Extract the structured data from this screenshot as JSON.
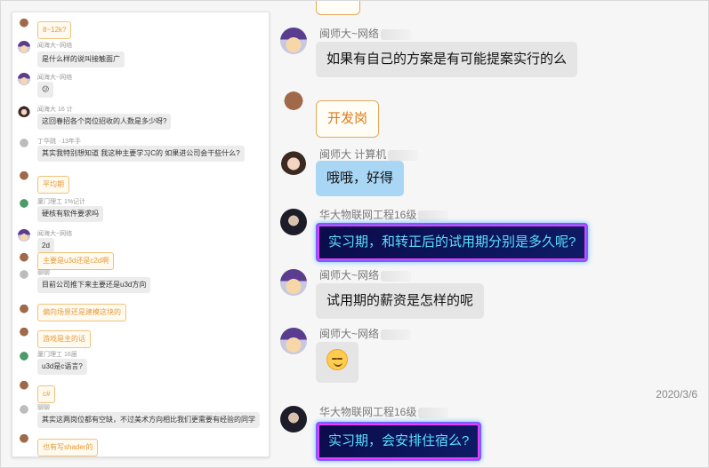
{
  "thumbnail_chat": {
    "messages": [
      {
        "name": "",
        "text": "8~12k?",
        "style": "orange",
        "avatar": "bear"
      },
      {
        "name": "闻海大~网络",
        "text": "是什么样的说叫接触面广",
        "style": "gray",
        "avatar": "kid"
      },
      {
        "name": "闻海大~网络",
        "text": "😕",
        "style": "gray",
        "avatar": "kid"
      },
      {
        "name": "闻海大 16 计",
        "text": "这回春招各个岗位招收的人数是多少呀?",
        "style": "gray",
        "avatar": "girl"
      },
      {
        "name": "丁华跳 · 13年手",
        "text": "其实我特别想知道 我这种主要学习C的 如果进公司会干些什么?",
        "style": "gray",
        "avatar": "grey"
      },
      {
        "name": "",
        "text": "平均期",
        "style": "orange",
        "avatar": "bear"
      },
      {
        "name": "厦门理工 1%记计",
        "text": "硬核有软件要求吗",
        "style": "gray",
        "avatar": "green"
      },
      {
        "name": "闻海大~网络",
        "text": "2d",
        "style": "gray",
        "avatar": "kid"
      },
      {
        "name": "",
        "text": "主要是u3d还是c2d啊",
        "style": "orange",
        "avatar": "bear"
      },
      {
        "name": "聊聊",
        "text": "目前公司推下来主要还是u3d方向",
        "style": "gray",
        "avatar": "grey"
      },
      {
        "name": "",
        "text": "偏向场景还是建模这块的",
        "style": "orange",
        "avatar": "bear"
      },
      {
        "name": "",
        "text": "游戏是主的话",
        "style": "orange",
        "avatar": "bear"
      },
      {
        "name": "厦门理工 16届",
        "text": "u3d是c语言?",
        "style": "gray",
        "avatar": "green"
      },
      {
        "name": "",
        "text": "c#",
        "style": "orange",
        "avatar": "bear"
      },
      {
        "name": "聊聊",
        "text": "其实这两岗位都有空缺，不过美术方向相比我们更需要有经验的同学",
        "style": "gray",
        "avatar": "grey"
      },
      {
        "name": "",
        "text": "也有写shader的",
        "style": "orange",
        "avatar": "bear"
      }
    ]
  },
  "main_chat": {
    "messages": [
      {
        "name": "闽师大~网络",
        "text": "如果有自己的方案是有可能提案实行的么",
        "style": "gray",
        "avatar": "kid"
      },
      {
        "name": "",
        "text": "开发岗",
        "style": "orange",
        "avatar": "bear"
      },
      {
        "name": "闽师大 计算机",
        "text": "哦哦，好得",
        "style": "blue",
        "avatar": "girl"
      },
      {
        "name": "华大物联网工程16级",
        "text": "实习期，和转正后的试用期分别是多久呢?",
        "style": "neon",
        "avatar": "guy"
      },
      {
        "name": "闽师大~网络",
        "text": "试用期的薪资是怎样的呢",
        "style": "gray",
        "avatar": "kid"
      },
      {
        "name": "闽师大~网络",
        "text": "",
        "emoji": "relieved-face-emoji",
        "style": "gray",
        "avatar": "kid"
      },
      {
        "name": "华大物联网工程16级",
        "text": "实习期，会安排住宿么?",
        "style": "neon",
        "avatar": "guy"
      }
    ],
    "timestamp": "2020/3/6"
  },
  "colors": {
    "gray_bubble": "#e5e5e5",
    "blue_bubble": "#a9d6f5",
    "orange_text": "#e07b1c",
    "neon_text": "#58e1ff"
  }
}
